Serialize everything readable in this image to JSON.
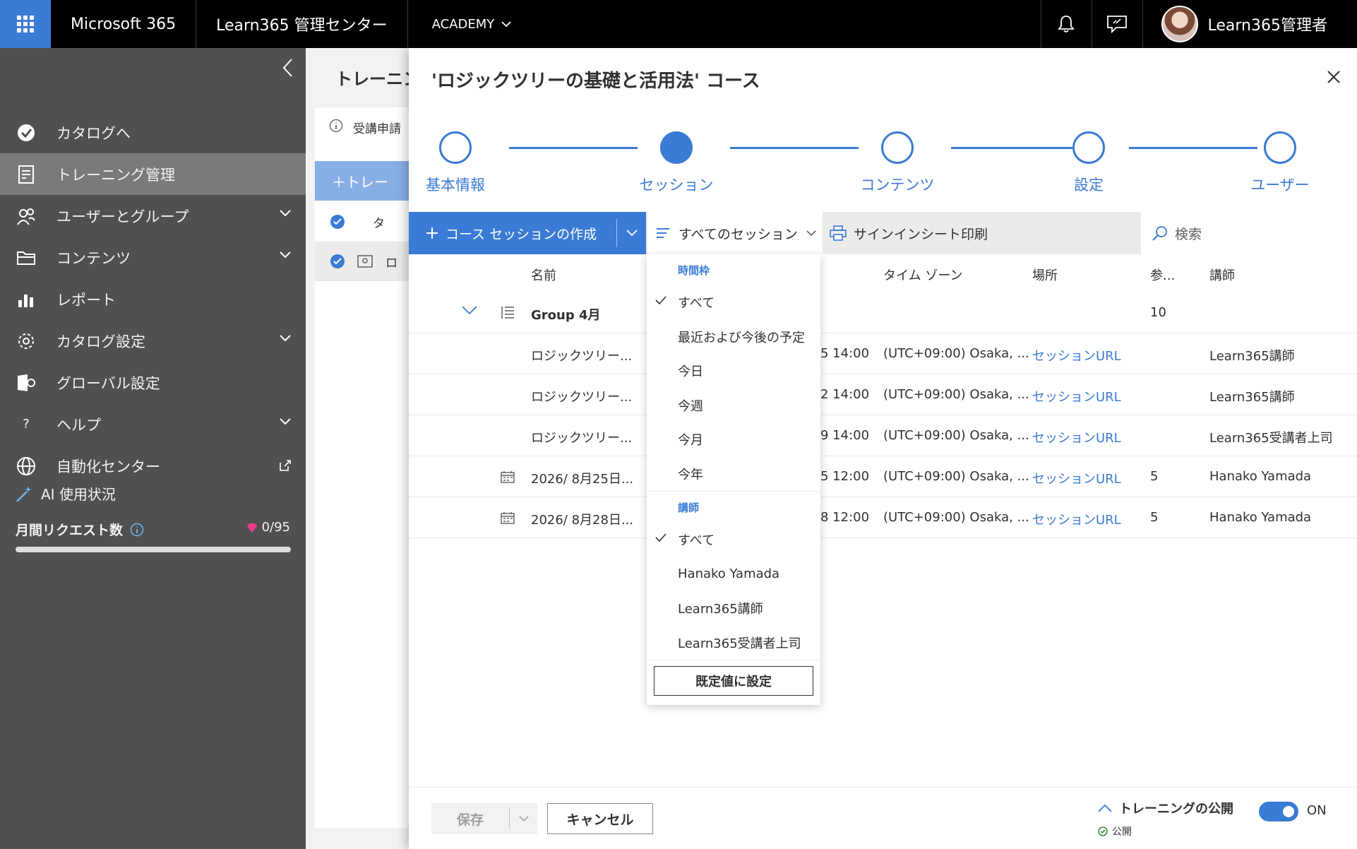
{
  "topbar": {
    "brand": "Microsoft 365",
    "app_name": "Learn365 管理センター",
    "tenant": "ACADEMY",
    "user_name": "Learn365管理者"
  },
  "sidebar": {
    "items": [
      {
        "label": "カタログへ",
        "icon": "catalog-icon"
      },
      {
        "label": "トレーニング管理",
        "icon": "training-icon",
        "active": true
      },
      {
        "label": "ユーザーとグループ",
        "icon": "users-icon",
        "expandable": true
      },
      {
        "label": "コンテンツ",
        "icon": "folder-icon",
        "expandable": true
      },
      {
        "label": "レポート",
        "icon": "chart-icon"
      },
      {
        "label": "カタログ設定",
        "icon": "gear-icon",
        "expandable": true
      },
      {
        "label": "グローバル設定",
        "icon": "global-settings-icon"
      },
      {
        "label": "ヘルプ",
        "icon": "help-icon",
        "expandable": true
      },
      {
        "label": "自動化センター",
        "icon": "globe-icon",
        "external": true
      }
    ],
    "ai": {
      "title": "AI 使用状況",
      "request_label": "月間リクエスト数",
      "request_count": "0/95",
      "usage_fraction": 0
    }
  },
  "background": {
    "title": "トレーニング",
    "info": "受講申請",
    "create_button": "トレー",
    "row1": "タ",
    "row2": "ロ"
  },
  "panel": {
    "title": "'ロジックツリーの基礎と活用法' コース",
    "steps": [
      {
        "label": "基本情報",
        "current": false
      },
      {
        "label": "セッション",
        "current": true
      },
      {
        "label": "コンテンツ",
        "current": false
      },
      {
        "label": "設定",
        "current": false
      },
      {
        "label": "ユーザー",
        "current": false
      }
    ],
    "commands": {
      "create": "コース セッションの作成",
      "filter": "すべてのセッション",
      "print": "サインインシート印刷",
      "search_placeholder": "検索"
    },
    "columns": {
      "name": "名前",
      "timezone": "タイム ゾーン",
      "location": "場所",
      "participants": "参...",
      "instructor": "講師"
    },
    "group": {
      "name": "Group 4月",
      "participants": "10"
    },
    "rows": [
      {
        "name": "ロジックツリー...",
        "time": "5 14:00",
        "timezone": "(UTC+09:00) Osaka, ...",
        "location": "セッションURL",
        "participants": "",
        "instructor": "Learn365講師",
        "calendar": false
      },
      {
        "name": "ロジックツリー...",
        "time": "2 14:00",
        "timezone": "(UTC+09:00) Osaka, ...",
        "location": "セッションURL",
        "participants": "",
        "instructor": "Learn365講師",
        "calendar": false
      },
      {
        "name": "ロジックツリー...",
        "time": "9 14:00",
        "timezone": "(UTC+09:00) Osaka, ...",
        "location": "セッションURL",
        "participants": "",
        "instructor": "Learn365受講者上司",
        "calendar": false
      },
      {
        "name": "2026/ 8月25日...",
        "time": "5 12:00",
        "timezone": "(UTC+09:00) Osaka, ...",
        "location": "セッションURL",
        "participants": "5",
        "instructor": "Hanako Yamada",
        "calendar": true
      },
      {
        "name": "2026/ 8月28日...",
        "time": "8 12:00",
        "timezone": "(UTC+09:00) Osaka, ...",
        "location": "セッションURL",
        "participants": "5",
        "instructor": "Hanako Yamada",
        "calendar": true
      }
    ],
    "dropdown": {
      "timeframe_header": "時間枠",
      "timeframe_items": [
        "すべて",
        "最近および今後の予定",
        "今日",
        "今週",
        "今月",
        "今年"
      ],
      "instructor_header": "講師",
      "instructor_items": [
        "すべて",
        "Hanako Yamada",
        "Learn365講師",
        "Learn365受講者上司"
      ],
      "default_button": "既定値に設定"
    },
    "footer": {
      "save": "保存",
      "cancel": "キャンセル",
      "publish_label": "トレーニングの公開",
      "publish_status": "公開",
      "toggle_state": "ON"
    }
  },
  "colors": {
    "accent": "#3a7bd5",
    "sidebar": "#505050",
    "topbar": "#000000"
  }
}
